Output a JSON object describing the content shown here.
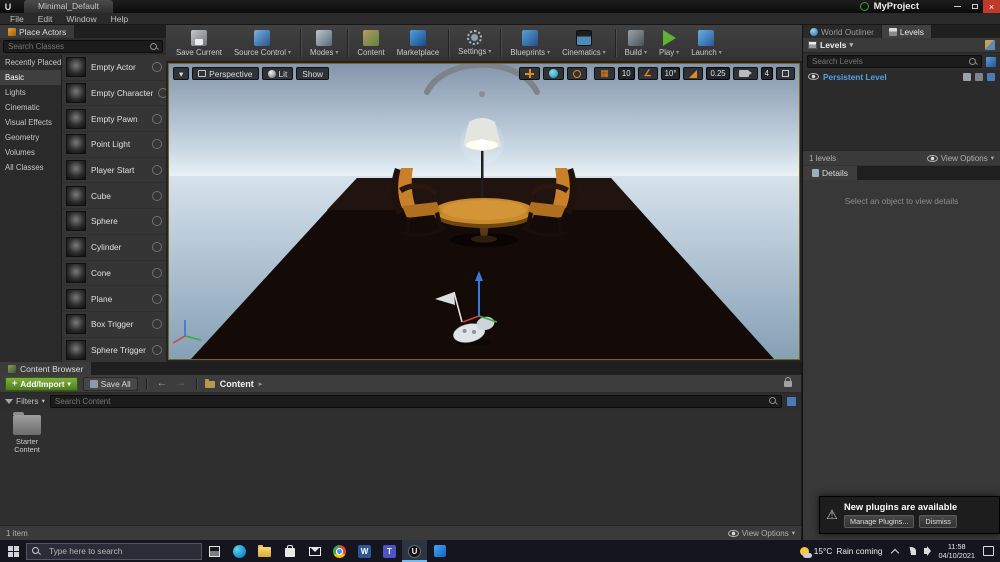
{
  "window": {
    "tab_title": "Minimal_Default",
    "project_name": "MyProject",
    "menu_items": [
      "File",
      "Edit",
      "Window",
      "Help"
    ]
  },
  "place_actors": {
    "title": "Place Actors",
    "search_placeholder": "Search Classes",
    "categories": [
      "Recently Placed",
      "Basic",
      "Lights",
      "Cinematic",
      "Visual Effects",
      "Geometry",
      "Volumes",
      "All Classes"
    ],
    "active_category": "Basic",
    "items": [
      "Empty Actor",
      "Empty Character",
      "Empty Pawn",
      "Point Light",
      "Player Start",
      "Cube",
      "Sphere",
      "Cylinder",
      "Cone",
      "Plane",
      "Box Trigger",
      "Sphere Trigger"
    ]
  },
  "toolbar": {
    "buttons": [
      {
        "label": "Save Current",
        "icon": "save-icon"
      },
      {
        "label": "Source Control",
        "icon": "source-control-icon"
      },
      {
        "label": "Modes",
        "icon": "modes-icon"
      },
      {
        "label": "Content",
        "icon": "content-icon"
      },
      {
        "label": "Marketplace",
        "icon": "marketplace-icon"
      },
      {
        "label": "Settings",
        "icon": "settings-gear-icon"
      },
      {
        "label": "Blueprints",
        "icon": "blueprints-icon"
      },
      {
        "label": "Cinematics",
        "icon": "cinematics-clapper-icon"
      },
      {
        "label": "Build",
        "icon": "build-icon"
      },
      {
        "label": "Play",
        "icon": "play-icon"
      },
      {
        "label": "Launch",
        "icon": "launch-icon"
      }
    ]
  },
  "viewport": {
    "camera_mode": "Perspective",
    "lighting_mode": "Lit",
    "show_label": "Show",
    "grid_snap_value": "10",
    "rotation_snap_value": "10°",
    "scale_snap_value": "0.25",
    "camera_speed_value": "4"
  },
  "levels_panel": {
    "tab_world_outliner": "World Outliner",
    "tab_levels": "Levels",
    "levels_dropdown_label": "Levels",
    "search_placeholder": "Search Levels",
    "level_name": "Persistent Level",
    "status": "1 levels",
    "view_options": "View Options"
  },
  "details_panel": {
    "tab": "Details",
    "empty_message": "Select an object to view details"
  },
  "plugins_notification": {
    "title": "New plugins are available",
    "manage_button": "Manage Plugins...",
    "dismiss_button": "Dismiss"
  },
  "content_browser": {
    "tab": "Content Browser",
    "add_import_button": "Add/Import",
    "save_all_button": "Save All",
    "path_root": "Content",
    "filters_label": "Filters",
    "search_placeholder": "Search Content",
    "folder_name": "Starter Content",
    "status": "1 item",
    "view_options": "View Options"
  },
  "taskbar": {
    "search_placeholder": "Type here to search",
    "temperature": "15°C",
    "condition": "Rain coming",
    "time": "11:58",
    "date": "04/10/2021"
  }
}
